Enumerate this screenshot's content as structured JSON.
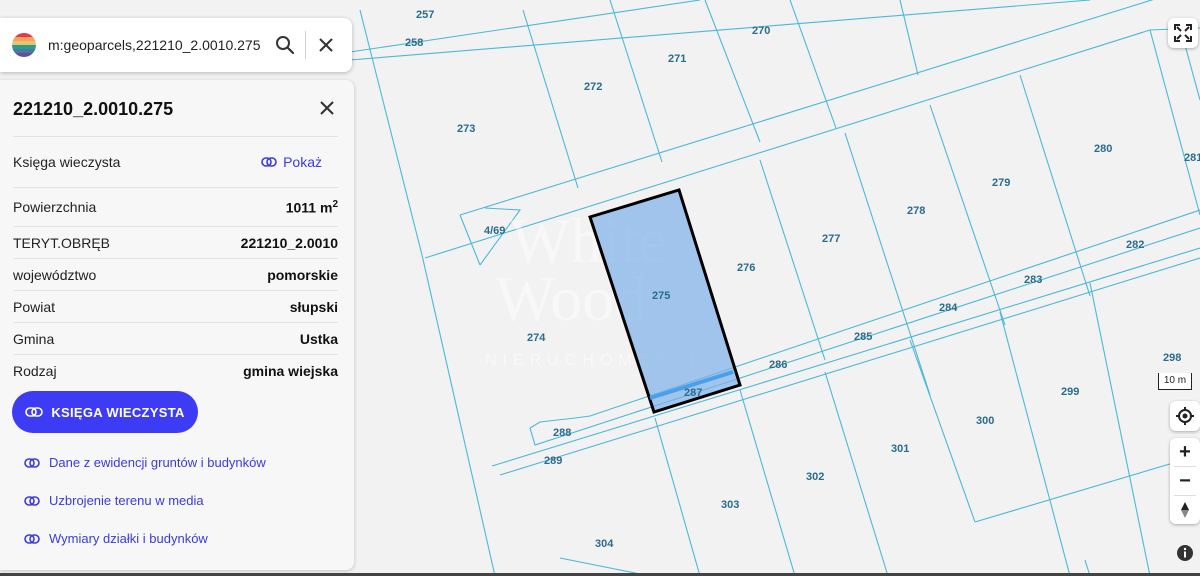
{
  "search": {
    "query": "m:geoparcels,221210_2.0010.275"
  },
  "parcel": {
    "id": "221210_2.0010.275",
    "rows": [
      {
        "label": "Księga wieczysta",
        "value": "Pokaż"
      },
      {
        "label": "Powierzchnia",
        "value": "1011 m",
        "unit_sup": "2"
      },
      {
        "label": "TERYT.OBRĘB",
        "value": "221210_2.0010"
      },
      {
        "label": "województwo",
        "value": "pomorskie"
      },
      {
        "label": "Powiat",
        "value": "słupski"
      },
      {
        "label": "Gmina",
        "value": "Ustka"
      },
      {
        "label": "Rodzaj",
        "value": "gmina wiejska"
      }
    ],
    "primary_button": "KSIĘGA WIECZYSTA",
    "links": [
      "Dane z ewidencji gruntów i budynków",
      "Uzbrojenie terenu w media",
      "Wymiary działki i budynków"
    ]
  },
  "map": {
    "scale_label": "10 m",
    "watermark": {
      "line1": "White",
      "line2": "Wood",
      "line3": "NIERUCHOMOŚCI"
    },
    "selected_parcel": "275",
    "parcel_labels": [
      "257",
      "258",
      "270",
      "271",
      "272",
      "273",
      "280",
      "281",
      "279",
      "278",
      "277",
      "276",
      "275",
      "4/69",
      "282",
      "283",
      "284",
      "285",
      "286",
      "287",
      "288",
      "289",
      "274",
      "298",
      "299",
      "300",
      "301",
      "302",
      "303",
      "304"
    ]
  },
  "colors": {
    "accent": "#3d3bf3",
    "parcel_line": "#4cb8d6",
    "selection": "#7fb0ea"
  },
  "icons": [
    "search-icon",
    "close-icon",
    "link-icon",
    "fullscreen-icon",
    "locate-icon",
    "compass-icon",
    "info-icon"
  ]
}
